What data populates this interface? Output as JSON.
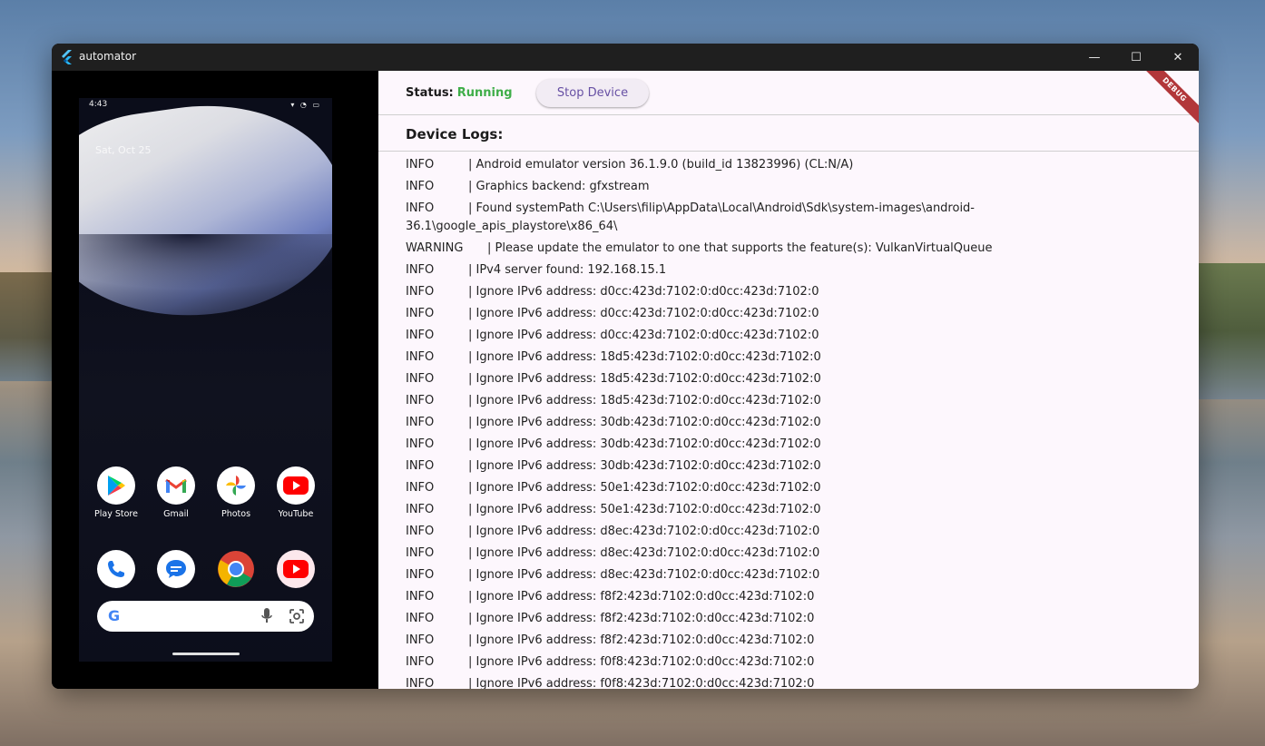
{
  "window": {
    "title": "automator",
    "controls": {
      "minimize": "—",
      "maximize": "☐",
      "close": "✕"
    }
  },
  "phone": {
    "time": "4:43",
    "status_icons": "▾ ◔ ▭",
    "date": "Sat, Oct 25",
    "apps_row1": [
      {
        "label": "Play Store",
        "icon": "play-store-icon"
      },
      {
        "label": "Gmail",
        "icon": "gmail-icon"
      },
      {
        "label": "Photos",
        "icon": "photos-icon"
      },
      {
        "label": "YouTube",
        "icon": "youtube-icon"
      }
    ],
    "dock": [
      {
        "icon": "phone-icon"
      },
      {
        "icon": "messages-icon"
      },
      {
        "icon": "chrome-icon"
      },
      {
        "icon": "youtube-music-icon"
      }
    ],
    "search": {
      "logo": "G"
    }
  },
  "status": {
    "label": "Status:",
    "value": "Running",
    "value_color": "#3fae49"
  },
  "stop_button": {
    "label": "Stop Device"
  },
  "debug_banner": "DEBUG",
  "logs": {
    "title": "Device Logs:",
    "entries": [
      {
        "level": "INFO",
        "message": "| Android emulator version 36.1.9.0 (build_id 13823996) (CL:N/A)"
      },
      {
        "level": "INFO",
        "message": "| Graphics backend: gfxstream"
      },
      {
        "level": "INFO",
        "message": "| Found systemPath C:\\Users\\filip\\AppData\\Local\\Android\\Sdk\\system-images\\android-36.1\\google_apis_playstore\\x86_64\\"
      },
      {
        "level": "WARNING",
        "message": "| Please update the emulator to one that supports the feature(s): VulkanVirtualQueue"
      },
      {
        "level": "INFO",
        "message": "| IPv4 server found: 192.168.15.1"
      },
      {
        "level": "INFO",
        "message": "| Ignore IPv6 address: d0cc:423d:7102:0:d0cc:423d:7102:0"
      },
      {
        "level": "INFO",
        "message": "| Ignore IPv6 address: d0cc:423d:7102:0:d0cc:423d:7102:0"
      },
      {
        "level": "INFO",
        "message": "| Ignore IPv6 address: d0cc:423d:7102:0:d0cc:423d:7102:0"
      },
      {
        "level": "INFO",
        "message": "| Ignore IPv6 address: 18d5:423d:7102:0:d0cc:423d:7102:0"
      },
      {
        "level": "INFO",
        "message": "| Ignore IPv6 address: 18d5:423d:7102:0:d0cc:423d:7102:0"
      },
      {
        "level": "INFO",
        "message": "| Ignore IPv6 address: 18d5:423d:7102:0:d0cc:423d:7102:0"
      },
      {
        "level": "INFO",
        "message": "| Ignore IPv6 address: 30db:423d:7102:0:d0cc:423d:7102:0"
      },
      {
        "level": "INFO",
        "message": "| Ignore IPv6 address: 30db:423d:7102:0:d0cc:423d:7102:0"
      },
      {
        "level": "INFO",
        "message": "| Ignore IPv6 address: 30db:423d:7102:0:d0cc:423d:7102:0"
      },
      {
        "level": "INFO",
        "message": "| Ignore IPv6 address: 50e1:423d:7102:0:d0cc:423d:7102:0"
      },
      {
        "level": "INFO",
        "message": "| Ignore IPv6 address: 50e1:423d:7102:0:d0cc:423d:7102:0"
      },
      {
        "level": "INFO",
        "message": "| Ignore IPv6 address: d8ec:423d:7102:0:d0cc:423d:7102:0"
      },
      {
        "level": "INFO",
        "message": "| Ignore IPv6 address: d8ec:423d:7102:0:d0cc:423d:7102:0"
      },
      {
        "level": "INFO",
        "message": "| Ignore IPv6 address: d8ec:423d:7102:0:d0cc:423d:7102:0"
      },
      {
        "level": "INFO",
        "message": "| Ignore IPv6 address: f8f2:423d:7102:0:d0cc:423d:7102:0"
      },
      {
        "level": "INFO",
        "message": "| Ignore IPv6 address: f8f2:423d:7102:0:d0cc:423d:7102:0"
      },
      {
        "level": "INFO",
        "message": "| Ignore IPv6 address: f8f2:423d:7102:0:d0cc:423d:7102:0"
      },
      {
        "level": "INFO",
        "message": "| Ignore IPv6 address: f0f8:423d:7102:0:d0cc:423d:7102:0"
      },
      {
        "level": "INFO",
        "message": "| Ignore IPv6 address: f0f8:423d:7102:0:d0cc:423d:7102:0"
      }
    ]
  }
}
